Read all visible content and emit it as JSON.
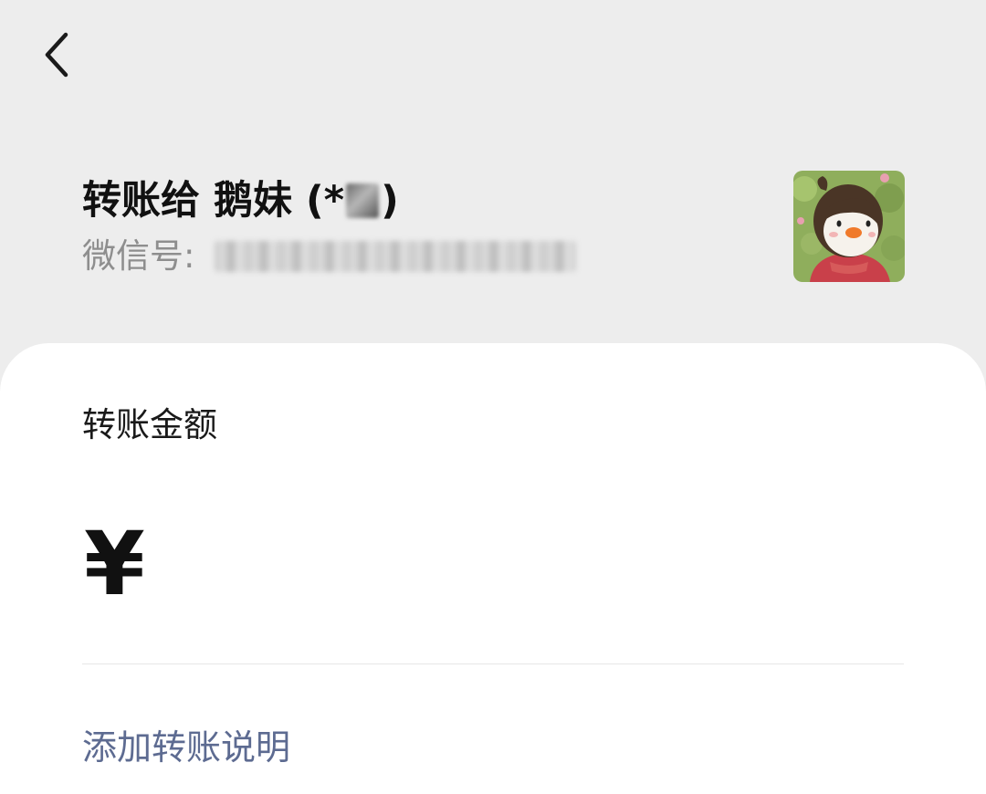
{
  "header": {
    "back_icon": "chevron-left-icon"
  },
  "recipient": {
    "title_prefix": "转账给 鹅妹 (*",
    "title_suffix": ")",
    "wechat_id_label": "微信号:",
    "avatar_icon": "cartoon-girl-avatar"
  },
  "transfer": {
    "amount_label": "转账金额",
    "currency_symbol": "¥",
    "amount_value": "",
    "add_note_label": "添加转账说明"
  },
  "colors": {
    "background": "#ededed",
    "card": "#ffffff",
    "link": "#5d6b91",
    "secondary_text": "#8e8e8e"
  }
}
